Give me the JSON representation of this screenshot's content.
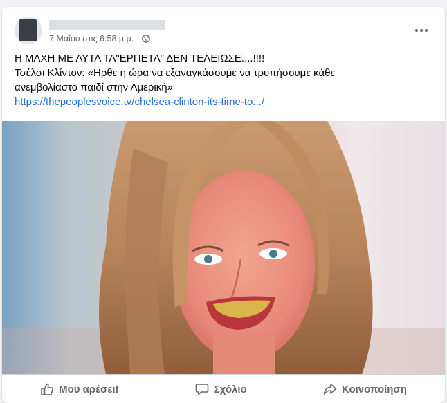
{
  "post": {
    "timestamp": "7 Μαΐου στις 6:58 μ.μ.",
    "separator": "·",
    "privacy_icon": "globe-icon",
    "text_line1": "Η ΜΑΧΗ ΜΕ ΑΥΤΑ ΤΑ\"ΕΡΠΕΤΑ\" ΔΕΝ ΤΕΛΕΙΩΣΕ....!!!!",
    "text_line2": "Τσέλσι Κλίντον: «Ηρθε η ώρα να εξαναγκάσουμε να τρυπήσουμε κάθε",
    "text_line3": "ανεμβολίαστο παιδί στην Αμερική»",
    "link": "https://thepeoplesvoice.tv/chelsea-clinton-its-time-to.../"
  },
  "actions": {
    "like_label": "Μου αρέσει!",
    "comment_label": "Σχόλιο",
    "share_label": "Κοινοποίηση"
  },
  "colors": {
    "link": "#216fdb",
    "muted": "#65676b"
  }
}
